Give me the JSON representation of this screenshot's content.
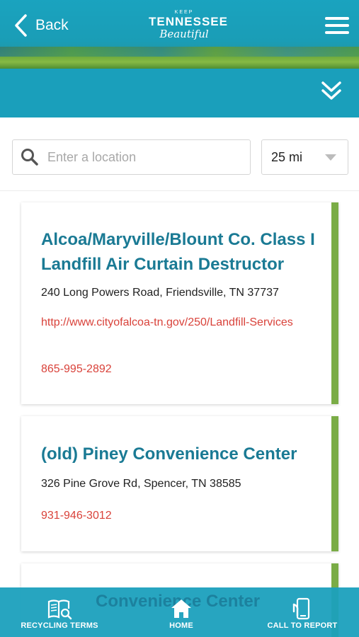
{
  "header": {
    "back_label": "Back",
    "logo": {
      "keep": "KEEP",
      "tennessee": "TENNESSEE",
      "beautiful": "Beautiful"
    }
  },
  "search": {
    "placeholder": "Enter a location",
    "value": "",
    "radius": "25 mi"
  },
  "results": [
    {
      "title": "Alcoa/Maryville/Blount Co. Class I Landfill Air Curtain Destructor",
      "address": "240 Long Powers Road, Friendsville, TN 37737",
      "url": "http://www.cityofalcoa-tn.gov/250/Landfill-Services",
      "phone": "865-995-2892"
    },
    {
      "title": "(old) Piney Convenience Center",
      "address": "326 Pine Grove Rd, Spencer, TN 38585",
      "phone": "931-946-3012"
    },
    {
      "title": "Convenience Center"
    }
  ],
  "bottom_nav": {
    "recycling_terms": "RECYCLING TERMS",
    "home": "HOME",
    "call_to_report": "CALL TO REPORT"
  },
  "colors": {
    "teal": "#1a9fbb",
    "title_teal": "#1a7a94",
    "link_red": "#d9423a",
    "accent_green": "#7aac46"
  }
}
